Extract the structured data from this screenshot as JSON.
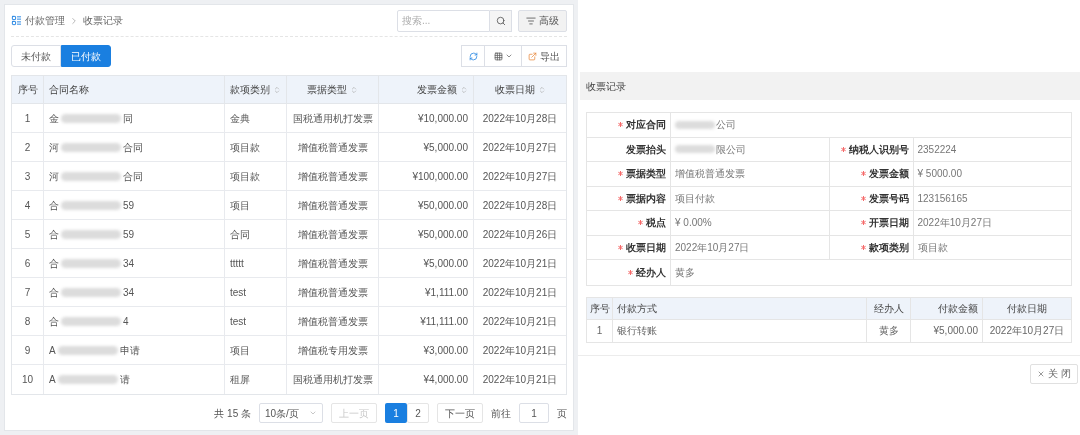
{
  "breadcrumb": [
    {
      "label": "付款管理"
    },
    {
      "label": "收票记录"
    }
  ],
  "search": {
    "placeholder": "搜索..."
  },
  "advanced_button": "高级",
  "tabs": [
    {
      "label": "未付款",
      "selected": false
    },
    {
      "label": "已付款",
      "selected": true
    }
  ],
  "export_button": "导出",
  "table": {
    "columns": [
      {
        "label": "序号",
        "sortable": false
      },
      {
        "label": "合同名称",
        "sortable": false
      },
      {
        "label": "款项类别",
        "sortable": true
      },
      {
        "label": "票据类型",
        "sortable": true
      },
      {
        "label": "发票金额",
        "sortable": true
      },
      {
        "label": "收票日期",
        "sortable": true
      }
    ],
    "rows": [
      {
        "no": "1",
        "name_prefix": "金",
        "name_suffix": "同",
        "category": "金典",
        "invoice_type": "国税通用机打发票",
        "amount": "¥10,000.00",
        "date": "2022年10月28日"
      },
      {
        "no": "2",
        "name_prefix": "河",
        "name_suffix": "合同",
        "category": "项目款",
        "invoice_type": "增值税普通发票",
        "amount": "¥5,000.00",
        "date": "2022年10月27日"
      },
      {
        "no": "3",
        "name_prefix": "河",
        "name_suffix": "合同",
        "category": "项目款",
        "invoice_type": "增值税普通发票",
        "amount": "¥100,000.00",
        "date": "2022年10月27日"
      },
      {
        "no": "4",
        "name_prefix": "合",
        "name_suffix": "59",
        "category": "项目",
        "invoice_type": "增值税普通发票",
        "amount": "¥50,000.00",
        "date": "2022年10月28日"
      },
      {
        "no": "5",
        "name_prefix": "合",
        "name_suffix": "59",
        "category": "合同",
        "invoice_type": "增值税普通发票",
        "amount": "¥50,000.00",
        "date": "2022年10月26日"
      },
      {
        "no": "6",
        "name_prefix": "合",
        "name_suffix": "34",
        "category": "ttttt",
        "invoice_type": "增值税普通发票",
        "amount": "¥5,000.00",
        "date": "2022年10月21日"
      },
      {
        "no": "7",
        "name_prefix": "合",
        "name_suffix": "34",
        "category": "test",
        "invoice_type": "增值税普通发票",
        "amount": "¥1,111.00",
        "date": "2022年10月21日"
      },
      {
        "no": "8",
        "name_prefix": "合",
        "name_suffix": "4",
        "category": "test",
        "invoice_type": "增值税普通发票",
        "amount": "¥11,111.00",
        "date": "2022年10月21日"
      },
      {
        "no": "9",
        "name_prefix": "A",
        "name_suffix": "申请",
        "category": "项目",
        "invoice_type": "增值税专用发票",
        "amount": "¥3,000.00",
        "date": "2022年10月21日"
      },
      {
        "no": "10",
        "name_prefix": "A",
        "name_suffix": "请",
        "category": "租屏",
        "invoice_type": "国税通用机打发票",
        "amount": "¥4,000.00",
        "date": "2022年10月21日"
      }
    ]
  },
  "pagination": {
    "total": "共 15 条",
    "page_size": "10条/页",
    "prev": "上一页",
    "prev_disabled": true,
    "pages": [
      {
        "label": "1",
        "selected": true
      },
      {
        "label": "2",
        "selected": false
      }
    ],
    "next": "下一页",
    "goto_label": "前往",
    "goto_value": "1",
    "goto_suffix": "页"
  },
  "modal": {
    "title": "收票记录",
    "form_rows": [
      [
        {
          "label": "对应合同",
          "required": true,
          "blurred": true,
          "value": "公司"
        }
      ],
      [
        {
          "label": "发票抬头",
          "required": false,
          "blurred": true,
          "value": "限公司"
        },
        {
          "label": "纳税人识别号",
          "required": true,
          "blurred": false,
          "value": "2352224"
        }
      ],
      [
        {
          "label": "票据类型",
          "required": true,
          "blurred": false,
          "value": "增值税普通发票"
        },
        {
          "label": "发票金额",
          "required": true,
          "blurred": false,
          "value": "¥ 5000.00"
        }
      ],
      [
        {
          "label": "票据内容",
          "required": true,
          "blurred": false,
          "value": "项目付款"
        },
        {
          "label": "发票号码",
          "required": true,
          "blurred": false,
          "value": "123156165"
        }
      ],
      [
        {
          "label": "税点",
          "required": true,
          "blurred": false,
          "value": "¥ 0.00%"
        },
        {
          "label": "开票日期",
          "required": true,
          "blurred": false,
          "value": "2022年10月27日"
        }
      ],
      [
        {
          "label": "收票日期",
          "required": true,
          "blurred": false,
          "value": "2022年10月27日"
        },
        {
          "label": "款项类别",
          "required": true,
          "blurred": false,
          "value": "项目款"
        }
      ],
      [
        {
          "label": "经办人",
          "required": true,
          "blurred": false,
          "value": "黄多"
        }
      ]
    ],
    "payments": {
      "columns": [
        {
          "label": "序号"
        },
        {
          "label": "付款方式"
        },
        {
          "label": "经办人"
        },
        {
          "label": "付款金额"
        },
        {
          "label": "付款日期"
        }
      ],
      "rows": [
        [
          "1",
          "银行转账",
          "黄多",
          "¥5,000.00",
          "2022年10月27日"
        ]
      ]
    },
    "close_button": "关 闭"
  }
}
